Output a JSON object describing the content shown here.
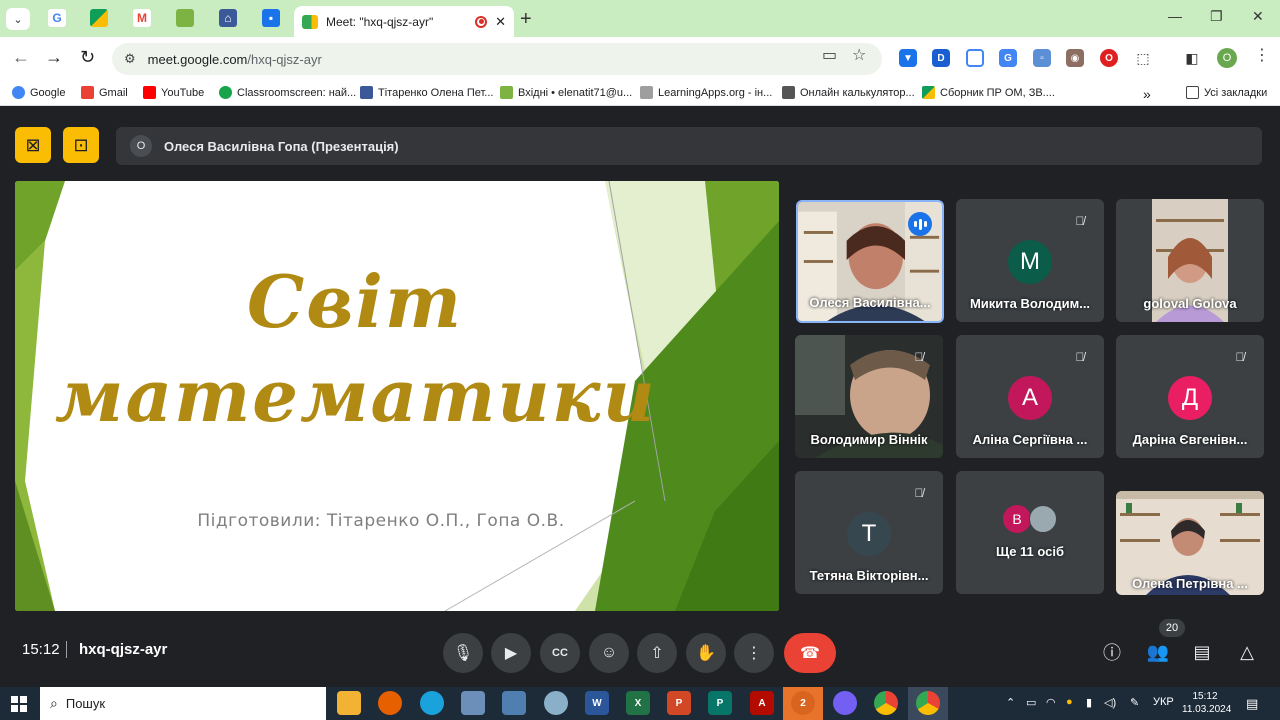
{
  "browser": {
    "active_tab_title": "Meet: \"hxq-qjsz-ayr\"",
    "url_host": "meet.google.com",
    "url_path": "/hxq-qjsz-ayr",
    "profile_initial": "O",
    "bookmarks": [
      {
        "label": "Google",
        "color": "#4285f4"
      },
      {
        "label": "Gmail",
        "color": "#ea4335"
      },
      {
        "label": "YouTube",
        "color": "#ff0000"
      },
      {
        "label": "Classroomscreen: най...",
        "color": "#16a34a"
      },
      {
        "label": "Тітаренко Олена Пет...",
        "color": "#3b5998"
      },
      {
        "label": "Вхідні • elenatit71@u...",
        "color": "#7cb342"
      },
      {
        "label": "LearningApps.org - ін...",
        "color": "#9e9e9e"
      },
      {
        "label": "Онлайн калькулятор...",
        "color": "#555555"
      },
      {
        "label": "Сборник ПР ОМ, ЗВ....",
        "color": "#fbbc04"
      }
    ],
    "all_bookmarks_label": "Усі закладки"
  },
  "meet": {
    "presenter_initial": "О",
    "presenter_label": "Олеся Василівна Гопа (Презентація)",
    "slide": {
      "title_line1": "Світ",
      "title_line2": "математики",
      "subtitle": "Підготовили: Тітаренко О.П., Гопа О.В."
    },
    "participants": [
      {
        "name": "Олеся Василівна...",
        "type": "video",
        "speaking": true
      },
      {
        "name": "Микита Володим...",
        "type": "avatar",
        "initial": "M",
        "color": "#0b5d4a",
        "muted": true
      },
      {
        "name": "goloval Golova",
        "type": "video",
        "muted": false
      },
      {
        "name": "Володимир Віннік",
        "type": "video",
        "muted": true
      },
      {
        "name": "Аліна Сергіївна ...",
        "type": "avatar",
        "initial": "A",
        "color": "#c2185b",
        "muted": true
      },
      {
        "name": "Даріна Євгенівн...",
        "type": "avatar",
        "initial": "Д",
        "color": "#e91e63",
        "muted": true
      },
      {
        "name": "Тетяна Вікторівн...",
        "type": "avatar",
        "initial": "T",
        "color": "#37474f",
        "muted": true
      },
      {
        "name": "Ще 11 осіб",
        "type": "more",
        "initial": "В",
        "color": "#c2185b"
      },
      {
        "name": "Олена Петрівна ...",
        "type": "video",
        "muted": false
      }
    ],
    "time": "15:12",
    "meeting_code": "hxq-qjsz-ayr",
    "people_count": "20"
  },
  "taskbar": {
    "search_placeholder": "Пошук",
    "language": "УКР",
    "time": "15:12",
    "date": "11.03.2024",
    "notification_count": "2"
  }
}
